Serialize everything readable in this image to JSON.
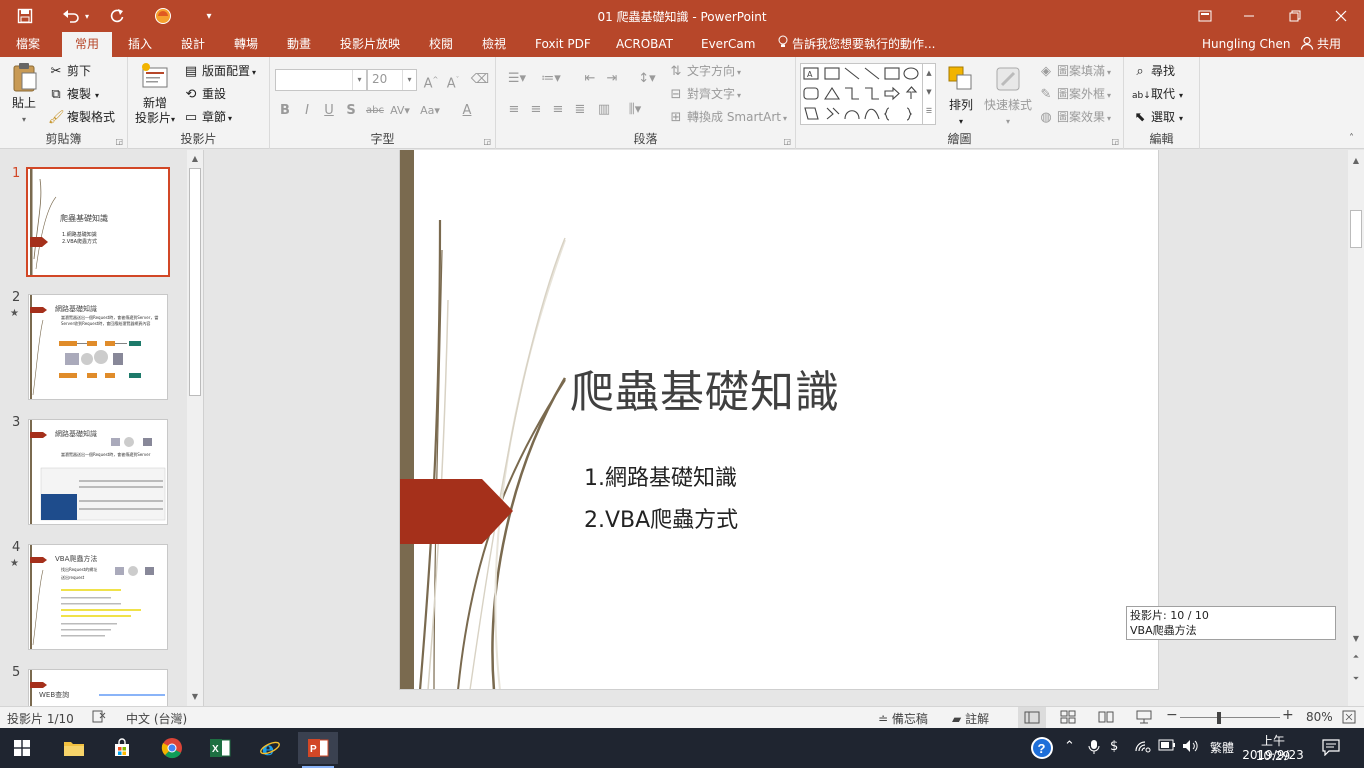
{
  "window": {
    "title": "01 爬蟲基礎知識 - PowerPoint",
    "user": "Hungling Chen",
    "share": "共用"
  },
  "tabs": [
    "檔案",
    "常用",
    "插入",
    "設計",
    "轉場",
    "動畫",
    "投影片放映",
    "校閱",
    "檢視",
    "Foxit PDF",
    "ACROBAT",
    "EverCam"
  ],
  "tell_me": "告訴我您想要執行的動作...",
  "ribbon": {
    "clipboard": {
      "label": "剪貼簿",
      "paste": "貼上",
      "cut": "剪下",
      "copy": "複製",
      "format_painter": "複製格式"
    },
    "slides": {
      "label": "投影片",
      "new_slide_1": "新增",
      "new_slide_2": "投影片",
      "layout": "版面配置",
      "reset": "重設",
      "section": "章節"
    },
    "font": {
      "label": "字型",
      "size": "20"
    },
    "paragraph": {
      "label": "段落",
      "text_direction": "文字方向",
      "align_text": "對齊文字",
      "smartart": "轉換成 SmartArt"
    },
    "drawing": {
      "label": "繪圖",
      "arrange": "排列",
      "quick_styles": "快速樣式",
      "fill": "圖案填滿",
      "outline": "圖案外框",
      "effects": "圖案效果"
    },
    "editing": {
      "label": "編輯",
      "find": "尋找",
      "replace": "取代",
      "select": "選取"
    }
  },
  "thumbnails": [
    {
      "num": "1",
      "title": "爬蟲基礎知識",
      "lines": [
        "1.網路基礎知識",
        "2.VBA爬蟲方式"
      ],
      "star": ""
    },
    {
      "num": "2",
      "title": "網路基礎知識",
      "lines": [
        "當瀏覽器送出一個Request時，會被傳遞到Server，當Server收到Request時，會回應給瀏覽器網頁內容"
      ],
      "star": "★"
    },
    {
      "num": "3",
      "title": "網路基礎知識",
      "lines": [
        "當瀏覽器送出一個Request時，會被傳遞到Server"
      ],
      "star": ""
    },
    {
      "num": "4",
      "title": "VBA爬蟲方法",
      "lines": [
        "找出Request的網址",
        "送出request"
      ],
      "star": "★"
    },
    {
      "num": "5",
      "title": "WEB查詢",
      "lines": [],
      "star": ""
    }
  ],
  "slide": {
    "title": "爬蟲基礎知識",
    "sub1": "1.網路基礎知識",
    "sub2": "2.VBA爬蟲方式"
  },
  "tooltip": {
    "line1": "投影片: 10 / 10",
    "line2": "VBA爬蟲方法"
  },
  "status": {
    "slide_info": "投影片 1/10",
    "language": "中文 (台灣)",
    "notes": "備忘稿",
    "comments": "註解",
    "zoom": "80%"
  },
  "taskbar": {
    "ime": "繁體",
    "time": "上午 10:29",
    "date": "2019/9/23"
  },
  "colors": {
    "accent": "#b7472a",
    "slide_arrow": "#a5301b",
    "slide_bar": "#7a6a4f"
  }
}
